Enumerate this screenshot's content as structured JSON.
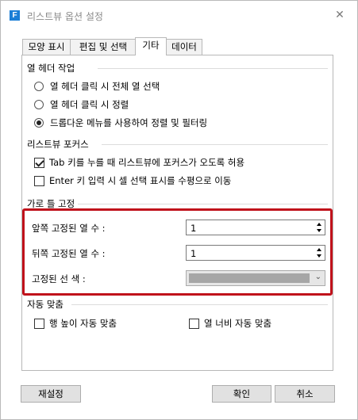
{
  "window": {
    "title": "리스트뷰 옵션 설정",
    "app_icon": "F",
    "close_glyph": "✕"
  },
  "tabs": [
    {
      "label": "모양 표시",
      "active": false
    },
    {
      "label": "편집 및 선택",
      "active": false
    },
    {
      "label": "기타",
      "active": true
    },
    {
      "label": "데이터",
      "active": false
    }
  ],
  "header_action": {
    "title": "열 헤더 작업",
    "options": [
      {
        "label": "열 헤더 클릭 시 전체 열 선택",
        "selected": false
      },
      {
        "label": "열 헤더 클릭 시 정렬",
        "selected": false
      },
      {
        "label": "드롭다운 메뉴를 사용하여 정렬 및 필터링",
        "selected": true
      }
    ]
  },
  "focus": {
    "title": "리스트뷰 포커스",
    "options": [
      {
        "label": "Tab 키를 누를 때 리스트뷰에 포커스가 오도록 허용",
        "checked": true
      },
      {
        "label": "Enter 키 입력 시 셀 선택 표시를 수평으로 이동",
        "checked": false
      }
    ]
  },
  "freeze": {
    "title": "가로 틀 고정",
    "front_label": "앞쪽 고정된 열 수 :",
    "front_value": "1",
    "back_label": "뒤쪽 고정된 열 수 :",
    "back_value": "1",
    "line_color_label": "고정된 선 색 :",
    "line_color": "#a6a6a6",
    "highlight_color": "#c0121b"
  },
  "autofit": {
    "title": "자동 맞춤",
    "row_height_label": "행 높이 자동 맞춤",
    "row_height_checked": false,
    "col_width_label": "열 너비 자동 맞춤",
    "col_width_checked": false
  },
  "footer": {
    "reset_label": "재설정",
    "ok_label": "확인",
    "cancel_label": "취소"
  }
}
